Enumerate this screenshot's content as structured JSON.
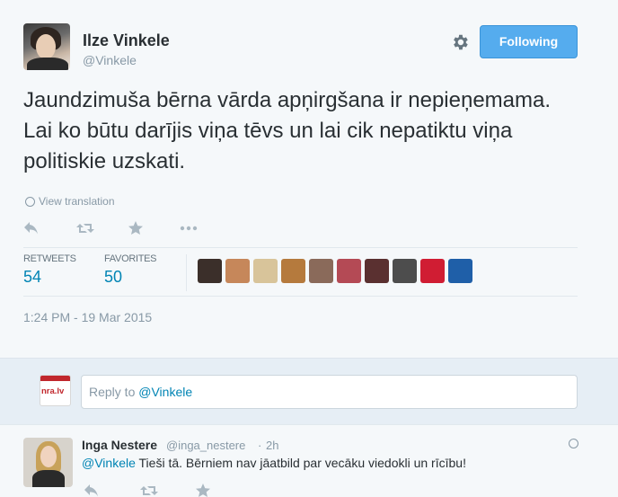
{
  "tweet": {
    "author_name": "Ilze Vinkele",
    "author_handle": "@Vinkele",
    "follow_label": "Following",
    "text": "Jaundzimuša bērna vārda apņirgšana ir nepieņemama. Lai ko būtu darījis viņa tēvs un lai cik nepatiktu viņa politiskie uzskati.",
    "view_translation": "View translation",
    "actions": [
      "reply-icon",
      "retweet-icon",
      "favorite-icon",
      "more-icon"
    ],
    "stats": {
      "retweets_label": "RETWEETS",
      "retweets_count": "54",
      "favorites_label": "FAVORITES",
      "favorites_count": "50"
    },
    "timestamp": "1:24 PM - 19 Mar 2015",
    "favoriter_avatar_colors": [
      "#3b2f2a",
      "#c6875a",
      "#d8c49a",
      "#b57a3d",
      "#8a6a5a",
      "#b44a55",
      "#5a3030",
      "#4d4d4d",
      "#d01d33",
      "#1f5fa8"
    ]
  },
  "reply_box": {
    "logo_text": "nra.lv",
    "placeholder_prefix": "Reply to ",
    "placeholder_mention": "@Vinkele"
  },
  "reply": {
    "author_name": "Inga Nestere",
    "author_handle": "@inga_nestere",
    "separator": "·",
    "time": "2h",
    "mention": "@Vinkele",
    "text": " Tieši tā. Bērniem nav jāatbild par vecāku viedokli un rīcību!"
  },
  "colors": {
    "accent": "#55acee",
    "link": "#0084b4",
    "muted": "#8899a6"
  }
}
